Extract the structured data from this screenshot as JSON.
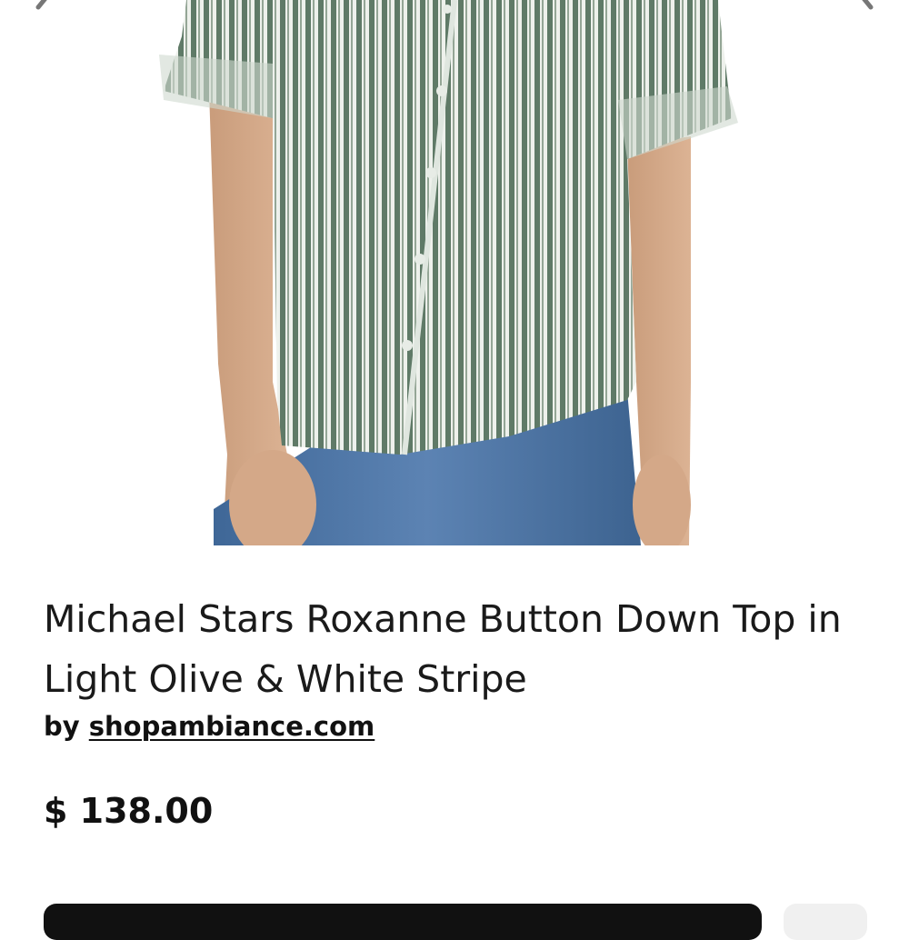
{
  "product": {
    "image_alt": "Striped button down top",
    "title": "Michael Stars Roxanne Button Down Top in Light Olive & White Stripe",
    "seller_prefix": "by ",
    "seller_name": "shopambiance.com",
    "price": "$ 138.00"
  },
  "icons": {
    "prev": "chevron-left-icon",
    "next": "chevron-right-icon"
  },
  "colors": {
    "text": "#111111",
    "stripe_olive": "#5f7a67",
    "denim": "#4f78a8",
    "button_dark": "#111111"
  }
}
